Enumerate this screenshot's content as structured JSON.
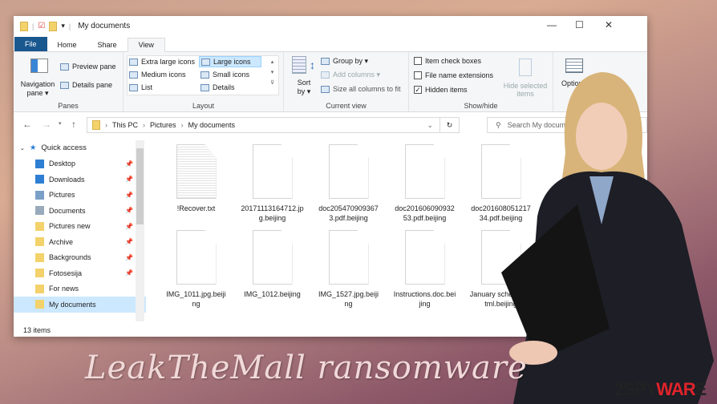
{
  "window": {
    "title": "My documents",
    "minimize": "—",
    "maximize": "☐",
    "close": "✕"
  },
  "tabs": [
    "File",
    "Home",
    "Share",
    "View"
  ],
  "ribbon": {
    "panes": {
      "label": "Panes",
      "navigation_pane": "Navigation pane ▾",
      "preview_pane": "Preview pane",
      "details_pane": "Details pane"
    },
    "layout": {
      "label": "Layout",
      "options": [
        "Extra large icons",
        "Large icons",
        "Medium icons",
        "Small icons",
        "List",
        "Details"
      ],
      "selected": "Large icons"
    },
    "current_view": {
      "label": "Current view",
      "sort_by": "Sort by ▾",
      "group_by": "Group by ▾",
      "add_columns": "Add columns ▾",
      "size_columns": "Size all columns to fit"
    },
    "show_hide": {
      "label": "Show/hide",
      "item_check_boxes": "Item check boxes",
      "file_name_extensions": "File name extensions",
      "hidden_items": "Hidden items",
      "hide_selected": "Hide selected items",
      "states": {
        "item_check_boxes": false,
        "file_name_extensions": false,
        "hidden_items": true
      }
    },
    "options": "Options"
  },
  "address": {
    "path": [
      "This PC",
      "Pictures",
      "My documents"
    ],
    "search_placeholder": "Search My documents"
  },
  "nav": {
    "quick_access": "Quick access",
    "items": [
      {
        "label": "Desktop",
        "pinned": true
      },
      {
        "label": "Downloads",
        "pinned": true
      },
      {
        "label": "Pictures",
        "pinned": true
      },
      {
        "label": "Documents",
        "pinned": true
      },
      {
        "label": "Pictures new",
        "pinned": true
      },
      {
        "label": "Archive",
        "pinned": true
      },
      {
        "label": "Backgrounds",
        "pinned": true
      },
      {
        "label": "Fotosesija",
        "pinned": true
      },
      {
        "label": "For news",
        "pinned": false
      },
      {
        "label": "My documents",
        "pinned": false,
        "selected": true
      }
    ]
  },
  "files": [
    "!Recover.txt",
    "20171113164712.jpg.beijing",
    "doc2054709093673.pdf.beijing",
    "doc20160609093253.pdf.beijing",
    "doc20160805121734.pdf.beijing",
    "IMG_1011.jpg.beijing",
    "IMG_1012.beijing",
    "IMG_1527.jpg.beijing",
    "Instructions.doc.beijing",
    "January schedule.xtml.beijing"
  ],
  "status": "13 items",
  "headline": "LeakTheMall ransomware",
  "logo": {
    "part1": "2SPY",
    "part2": "WAR",
    "part3": "E"
  }
}
